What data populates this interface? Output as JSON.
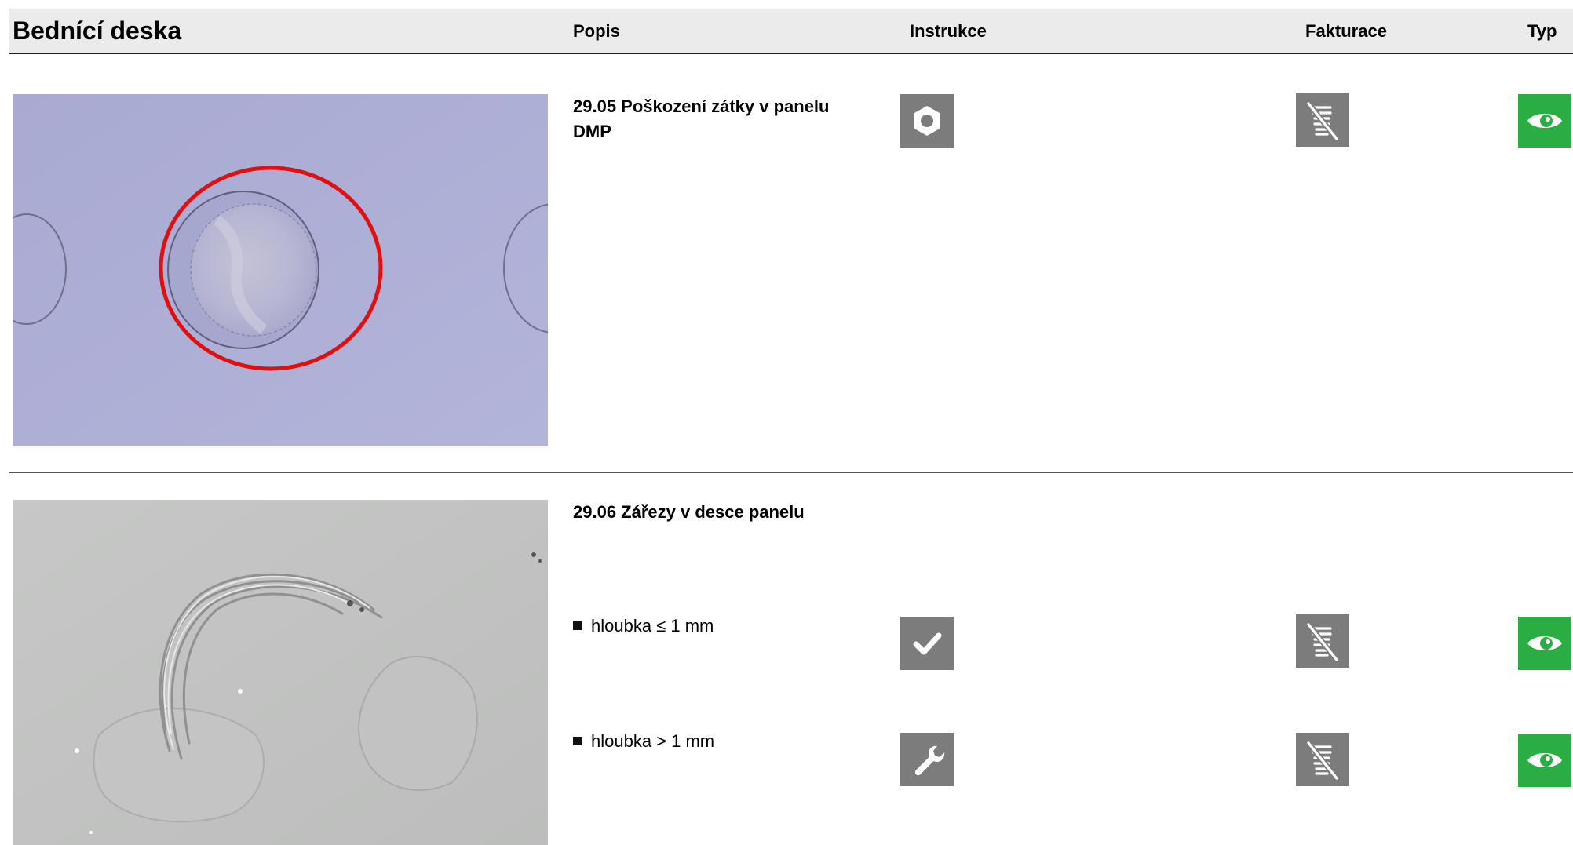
{
  "header": {
    "title": "Bednící deska",
    "col_popis": "Popis",
    "col_instrukce": "Instrukce",
    "col_fakturace": "Fakturace",
    "col_typ": "Typ"
  },
  "rows": [
    {
      "title": "29.05 Poškození zátky v panelu DMP",
      "instrukce_icon": "hexagon-nut-icon",
      "fakturace_icon": "no-billing-coins-icon",
      "typ_icon": "eye-icon"
    },
    {
      "title": "29.06 Zářezy v desce panelu",
      "items": [
        {
          "label": "hloubka ≤ 1 mm",
          "instrukce_icon": "checkmark-icon",
          "fakturace_icon": "no-billing-coins-icon",
          "typ_icon": "eye-icon"
        },
        {
          "label": "hloubka > 1 mm",
          "instrukce_icon": "wrench-icon",
          "fakturace_icon": "no-billing-coins-icon",
          "typ_icon": "eye-icon"
        }
      ]
    }
  ],
  "colors": {
    "header_bg": "#ebebeb",
    "icon_gray": "#7c7c7c",
    "icon_green": "#2aae43",
    "highlight_circle": "#e01010"
  }
}
